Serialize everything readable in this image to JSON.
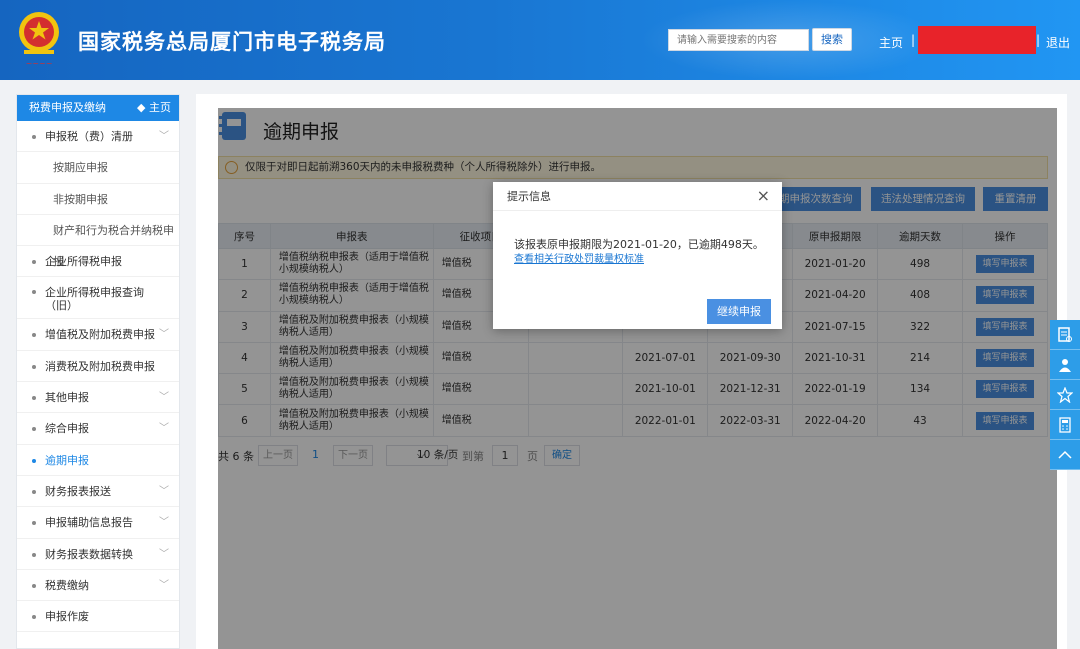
{
  "header": {
    "site_title": "国家税务总局厦门市电子税务局",
    "search_placeholder": "请输入需要搜索的内容",
    "search_label": "搜索",
    "home_label": "主页",
    "separator": "|",
    "logout_label": "退出"
  },
  "sidebar": {
    "title": "税费申报及缴纳",
    "home_label": "◆ 主页",
    "items": [
      {
        "label": "申报税（费）清册",
        "expandable": true
      },
      {
        "label": "按期应申报",
        "sub": true
      },
      {
        "label": "非按期申报",
        "sub": true
      },
      {
        "label": "财产和行为税合并纳税申报",
        "sub": true
      },
      {
        "label": "企业所得税申报",
        "expandable": false
      },
      {
        "label": "企业所得税申报查询（旧）",
        "expandable": false
      },
      {
        "label": "增值税及附加税费申报",
        "expandable": true
      },
      {
        "label": "消费税及附加税费申报",
        "expandable": false
      },
      {
        "label": "其他申报",
        "expandable": true
      },
      {
        "label": "综合申报",
        "expandable": true
      },
      {
        "label": "逾期申报",
        "expandable": false,
        "active": true
      },
      {
        "label": "财务报表报送",
        "expandable": true
      },
      {
        "label": "申报辅助信息报告",
        "expandable": true
      },
      {
        "label": "财务报表数据转换",
        "expandable": true
      },
      {
        "label": "税费缴纳",
        "expandable": true
      },
      {
        "label": "申报作废",
        "expandable": false
      }
    ]
  },
  "main": {
    "title": "逾期申报",
    "notice": "仅限于对即日起前溯360天内的未申报税费种（个人所得税除外）进行申报。",
    "buttons": {
      "query_count": "逾期申报次数查询",
      "illegal_query": "违法处理情况查询",
      "reset_list": "重置清册"
    },
    "table": {
      "headers": [
        "序号",
        "申报表",
        "征收项目",
        "",
        "",
        "",
        "原申报期限",
        "逾期天数",
        "操作"
      ],
      "rows": [
        {
          "no": "1",
          "form": "增值税纳税申报表（适用于增值税小规模纳税人）",
          "item": "增值税",
          "start": "",
          "end": "",
          "deadline": "2021-01-20",
          "days": "498",
          "action": "填写申报表"
        },
        {
          "no": "2",
          "form": "增值税纳税申报表（适用于增值税小规模纳税人）",
          "item": "增值税",
          "start": "",
          "end": "",
          "deadline": "2021-04-20",
          "days": "408",
          "action": "填写申报表"
        },
        {
          "no": "3",
          "form": "增值税及附加税费申报表（小规模纳税人适用）",
          "item": "增值税",
          "start": "",
          "end": "",
          "deadline": "2021-07-15",
          "days": "322",
          "action": "填写申报表"
        },
        {
          "no": "4",
          "form": "增值税及附加税费申报表（小规模纳税人适用）",
          "item": "增值税",
          "start": "2021-07-01",
          "end": "2021-09-30",
          "deadline": "2021-10-31",
          "days": "214",
          "action": "填写申报表"
        },
        {
          "no": "5",
          "form": "增值税及附加税费申报表（小规模纳税人适用）",
          "item": "增值税",
          "start": "2021-10-01",
          "end": "2021-12-31",
          "deadline": "2022-01-19",
          "days": "134",
          "action": "填写申报表"
        },
        {
          "no": "6",
          "form": "增值税及附加税费申报表（小规模纳税人适用）",
          "item": "增值税",
          "start": "2022-01-01",
          "end": "2022-03-31",
          "deadline": "2022-04-20",
          "days": "43",
          "action": "填写申报表"
        }
      ]
    },
    "pager": {
      "total": "共 6 条",
      "prev": "上一页",
      "current_page": "1",
      "next": "下一页",
      "page_size": "10 条/页",
      "goto_label": "到第",
      "goto_value": "1",
      "page_unit": "页",
      "confirm": "确定"
    }
  },
  "modal": {
    "title": "提示信息",
    "close": "×",
    "message": "该报表原申报期限为2021-01-20，已逾期498天。",
    "link": "查看相关行政处罚裁量权标准",
    "confirm": "继续申报"
  },
  "float_tools": [
    "form-icon",
    "person-icon",
    "star-icon",
    "calculator-icon",
    "up-arrow-icon"
  ],
  "colors": {
    "header_blue": "#1976d2",
    "accent": "#4a90e2",
    "redacted": "#e8232a"
  }
}
